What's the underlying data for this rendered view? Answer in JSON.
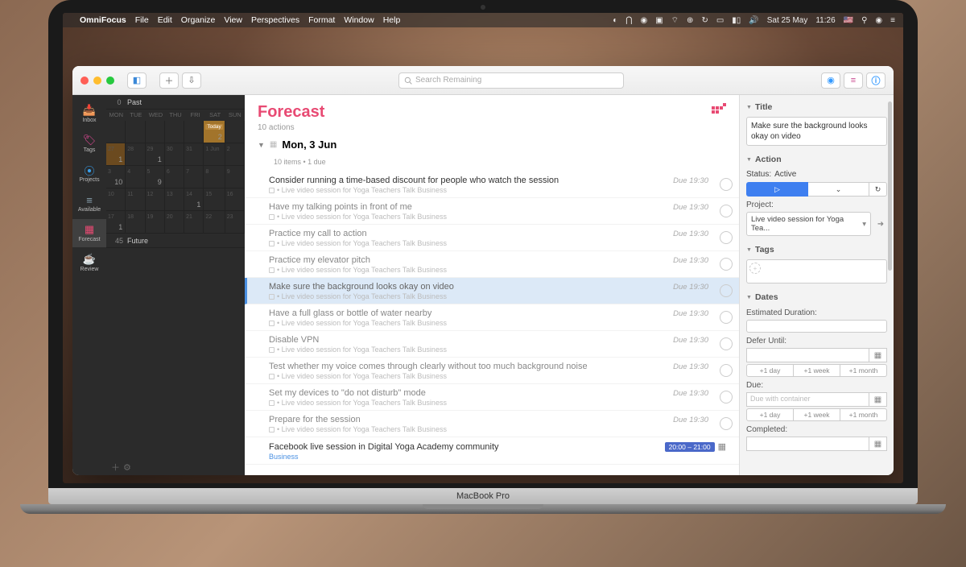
{
  "menubar": {
    "apple": "",
    "app": "OmniFocus",
    "items": [
      "File",
      "Edit",
      "Organize",
      "View",
      "Perspectives",
      "Format",
      "Window",
      "Help"
    ],
    "date": "Sat 25 May",
    "time": "11:26"
  },
  "search": {
    "placeholder": "Search Remaining"
  },
  "device_label": "MacBook Pro",
  "perspectives": [
    {
      "label": "Inbox",
      "icon": "📥",
      "color": "#707fdb"
    },
    {
      "label": "Tags",
      "icon": "🏷",
      "color": "#e84a9a"
    },
    {
      "label": "Projects",
      "icon": "⦿",
      "color": "#39a0ed"
    },
    {
      "label": "Available",
      "icon": "≡",
      "color": "#8aa1b0"
    },
    {
      "label": "Forecast",
      "icon": "▦",
      "color": "#e84a73",
      "active": true
    },
    {
      "label": "Review",
      "icon": "☕",
      "color": "#d4a05a"
    }
  ],
  "calendar": {
    "past": {
      "count": "0",
      "label": "Past"
    },
    "days": [
      "MON",
      "TUE",
      "WED",
      "THU",
      "FRI",
      "SAT",
      "SUN"
    ],
    "rows": [
      [
        {
          "d": ""
        },
        {
          "d": ""
        },
        {
          "d": ""
        },
        {
          "d": ""
        },
        {
          "d": ""
        },
        {
          "d": "Today",
          "n": "2",
          "today": true
        },
        {
          "d": ""
        }
      ],
      [
        {
          "d": "27",
          "n": "1",
          "hi": true
        },
        {
          "d": "28"
        },
        {
          "d": "29",
          "n": "1"
        },
        {
          "d": "30"
        },
        {
          "d": "31"
        },
        {
          "d": "1 Jun"
        },
        {
          "d": "2"
        }
      ],
      [
        {
          "d": "3",
          "n": "10"
        },
        {
          "d": "4"
        },
        {
          "d": "5",
          "n": "9"
        },
        {
          "d": "6"
        },
        {
          "d": "7"
        },
        {
          "d": "8"
        },
        {
          "d": "9"
        }
      ],
      [
        {
          "d": "10"
        },
        {
          "d": "11"
        },
        {
          "d": "12"
        },
        {
          "d": "13"
        },
        {
          "d": "14",
          "n": "1"
        },
        {
          "d": "15"
        },
        {
          "d": "16"
        }
      ],
      [
        {
          "d": "17",
          "n": "1"
        },
        {
          "d": "18"
        },
        {
          "d": "19"
        },
        {
          "d": "20"
        },
        {
          "d": "21"
        },
        {
          "d": "22"
        },
        {
          "d": "23"
        }
      ]
    ],
    "future": {
      "count": "45",
      "label": "Future"
    }
  },
  "main": {
    "title": "Forecast",
    "subtitle": "10 actions",
    "section": {
      "title": "Mon, 3 Jun",
      "subtitle": "10 items • 1 due"
    },
    "project_line": "Live video session for Yoga Teachers Talk Business",
    "due_label": "Due 19:30",
    "tasks": [
      {
        "title": "Consider running a time-based discount for people who watch the session"
      },
      {
        "title": "Have my talking points in front of me"
      },
      {
        "title": "Practice my call to action"
      },
      {
        "title": "Practice my elevator pitch"
      },
      {
        "title": "Make sure the background looks okay on video",
        "selected": true
      },
      {
        "title": "Have a full glass or bottle of water nearby"
      },
      {
        "title": "Disable VPN"
      },
      {
        "title": "Test whether my voice comes through clearly without too much background noise"
      },
      {
        "title": "Set my devices to \"do not disturb\" mode"
      },
      {
        "title": "Prepare for the session"
      }
    ],
    "event": {
      "title": "Facebook live session in Digital Yoga Academy community",
      "project": "Business",
      "time": "20:00 – 21:00"
    }
  },
  "inspector": {
    "title_section": "Title",
    "title_value": "Make sure the background looks okay on video",
    "action_section": "Action",
    "status_label": "Status:",
    "status_value": "Active",
    "project_label": "Project:",
    "project_value": "Live video session for Yoga Tea...",
    "tags_section": "Tags",
    "dates_section": "Dates",
    "est_label": "Estimated Duration:",
    "defer_label": "Defer Until:",
    "due_label": "Due:",
    "due_placeholder": "Due with container",
    "completed_label": "Completed:",
    "quick": [
      "+1 day",
      "+1 week",
      "+1 month"
    ]
  }
}
